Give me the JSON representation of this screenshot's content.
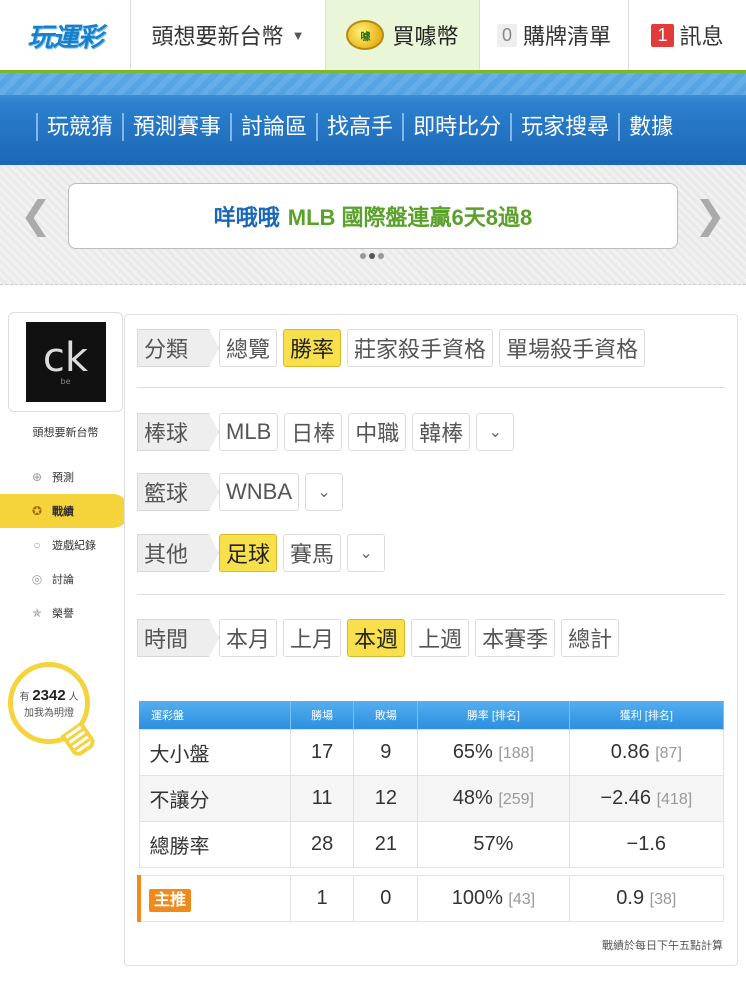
{
  "header": {
    "logo_text": "玩運彩",
    "username": "頭想要新台幣",
    "buy_label": "買噱幣",
    "coin_text": "噱",
    "list_label": "購牌清單",
    "list_count": "0",
    "msg_label": "訊息",
    "msg_count": "1"
  },
  "nav": {
    "items": [
      "玩競猜",
      "預測賽事",
      "討論區",
      "找高手",
      "即時比分",
      "玩家搜尋",
      "數據"
    ]
  },
  "banner": {
    "who": "咩哦哦",
    "what": "MLB 國際盤連贏6天8過8",
    "page_dots": 3,
    "active_dot": 2
  },
  "sidebar": {
    "avatar_text": "ck",
    "avatar_sub": "be",
    "username": "頭想要新台幣",
    "menu": [
      {
        "label": "預測",
        "icon": "crosshair-icon"
      },
      {
        "label": "戰績",
        "icon": "trophy-icon",
        "active": true
      },
      {
        "label": "遊戲紀錄",
        "icon": "circle-icon"
      },
      {
        "label": "討論",
        "icon": "chat-icon"
      },
      {
        "label": "榮譽",
        "icon": "medal-icon"
      }
    ],
    "lamp_prefix": "有",
    "lamp_count": "2342",
    "lamp_suffix": "人",
    "lamp_text": "加我為明燈"
  },
  "filters": {
    "category": {
      "label": "分類",
      "options": [
        "總覽",
        "勝率",
        "莊家殺手資格",
        "單場殺手資格"
      ],
      "selected": "勝率"
    },
    "baseball": {
      "label": "棒球",
      "options": [
        "MLB",
        "日棒",
        "中職",
        "韓棒"
      ]
    },
    "basketball": {
      "label": "籃球",
      "options": [
        "WNBA"
      ]
    },
    "other": {
      "label": "其他",
      "options": [
        "足球",
        "賽馬"
      ],
      "selected": "足球"
    },
    "time": {
      "label": "時間",
      "options": [
        "本月",
        "上月",
        "本週",
        "上週",
        "本賽季",
        "總計"
      ],
      "selected": "本週"
    }
  },
  "table": {
    "headers": [
      "運彩盤",
      "勝場",
      "敗場",
      "勝率 [排名]",
      "獲利 [排名]"
    ],
    "rows": [
      {
        "name": "大小盤",
        "win": "17",
        "loss": "9",
        "rate": "65%",
        "rate_rank": "[188]",
        "profit": "0.86",
        "profit_rank": "[87]"
      },
      {
        "name": "不讓分",
        "win": "11",
        "loss": "12",
        "rate": "48%",
        "rate_rank": "[259]",
        "profit": "−2.46",
        "profit_rank": "[418]"
      },
      {
        "name": "總勝率",
        "win": "28",
        "loss": "21",
        "rate": "57%",
        "rate_rank": "",
        "profit": "−1.6",
        "profit_rank": ""
      }
    ],
    "main_pick": {
      "name": "主推",
      "win": "1",
      "loss": "0",
      "rate": "100%",
      "rate_rank": "[43]",
      "profit": "0.9",
      "profit_rank": "[38]"
    },
    "note": "戰績於每日下午五點計算"
  },
  "colors": {
    "accent_yellow": "#f7e04b",
    "nav_blue": "#1a67b6",
    "brand_green": "#7ab82c",
    "main_pick_orange": "#ef8a1b"
  }
}
